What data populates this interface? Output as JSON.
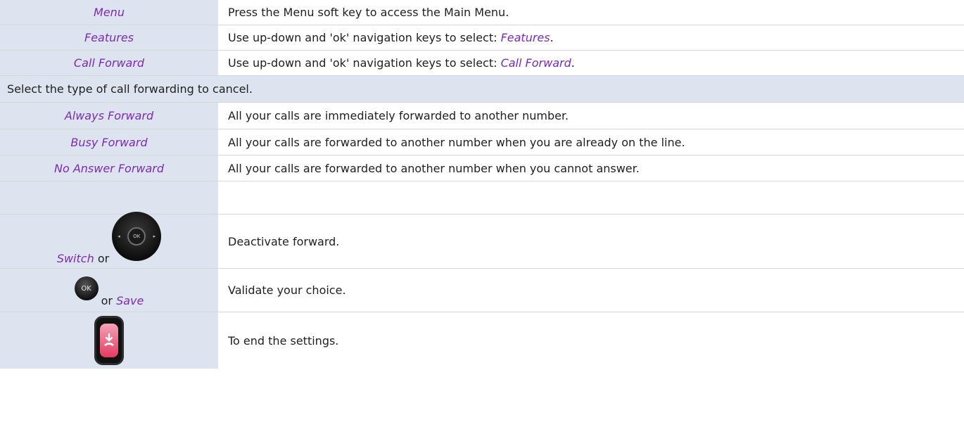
{
  "rows": [
    {
      "key": "Menu",
      "desc": "Press the Menu soft key to access the Main Menu."
    },
    {
      "key": "Features",
      "desc_prefix": "Use up-down and 'ok' navigation keys to select: ",
      "desc_em": "Features",
      "desc_suffix": "."
    },
    {
      "key": "Call Forward",
      "desc_prefix": "Use up-down and 'ok' navigation keys to select: ",
      "desc_em": "Call Forward",
      "desc_suffix": "."
    }
  ],
  "section_header": "Select the type of call forwarding to cancel.",
  "forward_types": [
    {
      "key": "Always Forward",
      "desc": "All your calls are immediately forwarded to another number."
    },
    {
      "key": "Busy Forward",
      "desc": "All your calls are forwarded to another number when you are already on the line."
    },
    {
      "key": "No Answer Forward",
      "desc": "All your calls are forwarded to another number when you cannot answer."
    }
  ],
  "steps": {
    "switch": {
      "key": "Switch",
      "or": "or",
      "desc": "Deactivate forward.",
      "nav_ok": "OK",
      "icon": "navigator-key-icon"
    },
    "save": {
      "key": "Save",
      "or": "or",
      "desc": "Validate your choice.",
      "ok_label": "OK",
      "icon": "ok-key-icon"
    },
    "end": {
      "desc": "To end the settings.",
      "icon": "hang-up-key-icon"
    }
  }
}
